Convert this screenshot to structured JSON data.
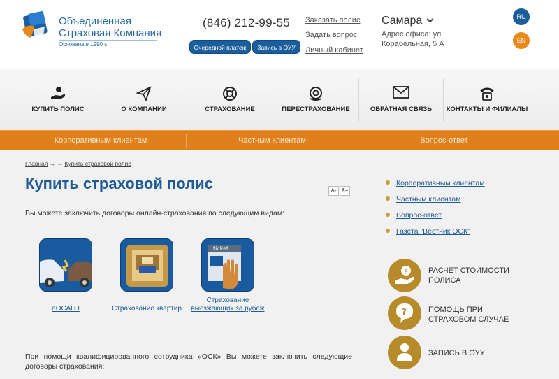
{
  "header": {
    "logo_name_line1": "Объединенная",
    "logo_name_line2": "Страховая Компания",
    "logo_sub": "Основана в 1990 г.",
    "phone": "(846) 212-99-55",
    "btn_payment": "Очередной платеж",
    "btn_appointment": "Запись в ОУУ",
    "link_call": "Заказать полис",
    "link_question": "Задать вопрос",
    "link_cabinet": "Личный кабинет",
    "city": "Самара",
    "address": "Адрес офиса: ул. Корабельная, 5 А",
    "lang_ru": "RU",
    "lang_en": "EN"
  },
  "nav": {
    "items": [
      {
        "label": "КУПИТЬ ПОЛИС",
        "icon": "hand-coin-icon"
      },
      {
        "label": "О КОМПАНИИ",
        "icon": "paper-plane-icon"
      },
      {
        "label": "СТРАХОВАНИЕ",
        "icon": "lifebuoy-icon"
      },
      {
        "label": "ПЕРЕСТРАХОВАНИЕ",
        "icon": "lifebuoy-hands-icon"
      },
      {
        "label": "ОБРАТНАЯ СВЯЗЬ",
        "icon": "envelope-icon"
      },
      {
        "label": "КОНТАКТЫ И ФИЛИАЛЫ",
        "icon": "telephone-icon"
      }
    ]
  },
  "subnav": {
    "items": [
      "Корпоративным клиентам",
      "Частным клиентам",
      "Вопрос-ответ"
    ]
  },
  "main": {
    "breadcrumb_home": "Главная",
    "breadcrumb_arrows": "→ →",
    "breadcrumb_current": "Купить страховой полис",
    "title": "Купить страховой полис",
    "font_dec": "A-",
    "font_inc": "A+",
    "intro": "Вы можете заключить договоры онлайн-страхования по следующим видам:",
    "cards": [
      {
        "label": "еОСАГО",
        "icon": "car-crash-icon"
      },
      {
        "label": "Страхование квартир",
        "icon": "apartment-room-icon"
      },
      {
        "label": "Страхование выезжающих за рубеж",
        "icon": "ticket-hand-icon"
      }
    ],
    "bottom_text": "При помощи квалифицированного сотрудника «ОСК» Вы можете заключить следующие договоры страхования:"
  },
  "sidebar": {
    "links": [
      "Корпоративным клиентам",
      "Частным клиентам",
      "Вопрос-ответ",
      "Газета \"Вестник ОСК\""
    ],
    "services": [
      {
        "label": "РАСЧЕТ СТОИМОСТИ ПОЛИСА",
        "icon": "hand-coin-icon"
      },
      {
        "label": "ПОМОЩЬ ПРИ СТРАХОВОМ СЛУЧАЕ",
        "icon": "question-bubble-icon"
      },
      {
        "label": "ЗАПИСЬ В ОУУ",
        "icon": "person-icon"
      }
    ]
  },
  "colors": {
    "brand_blue": "#1f5c95",
    "accent_orange": "#e0801a",
    "gold": "#b88b2a"
  }
}
